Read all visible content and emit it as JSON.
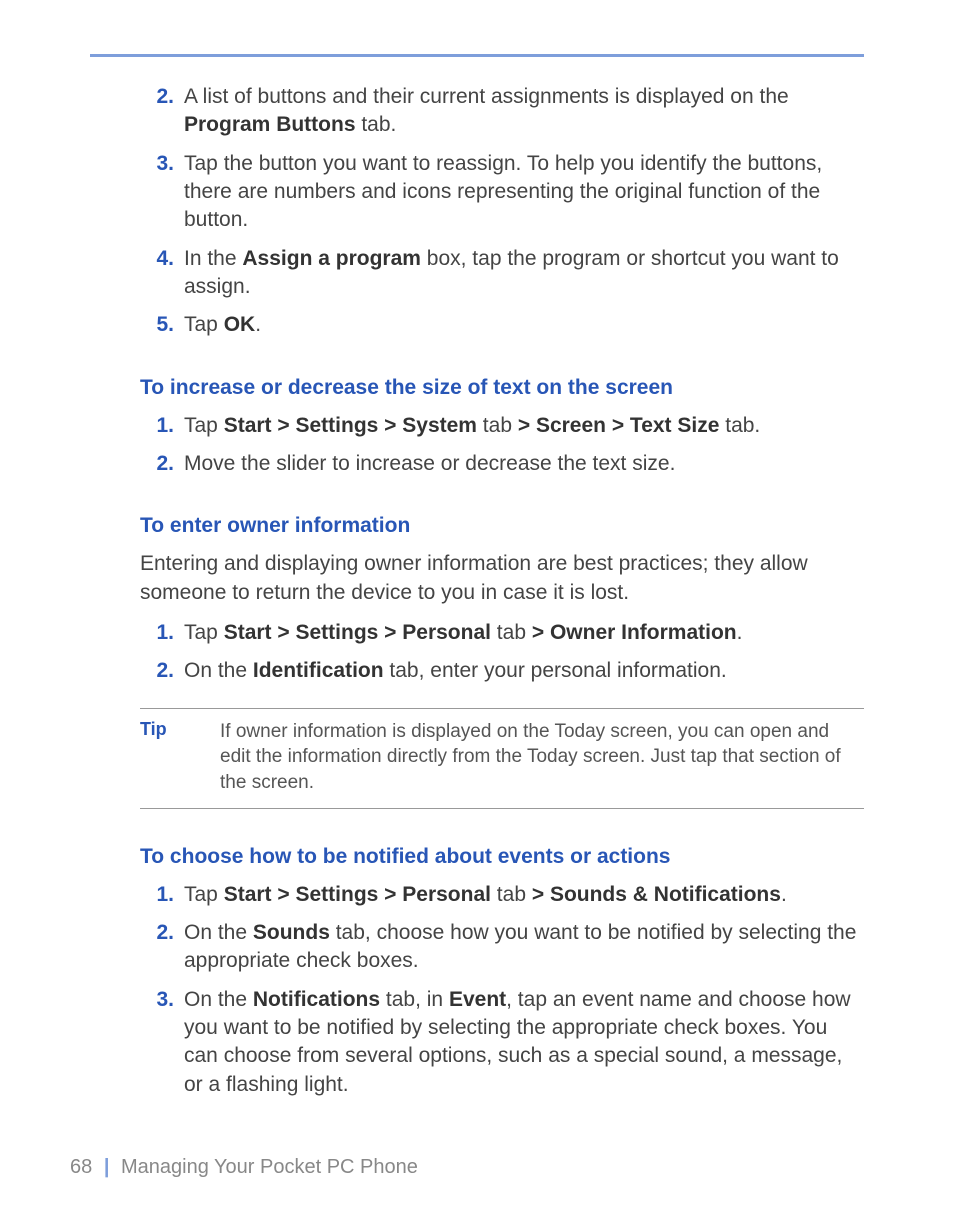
{
  "steps_top": [
    {
      "n": "2.",
      "html": "A list of buttons and their current assignments is displayed on the <span class='b'>Program Buttons</span> tab."
    },
    {
      "n": "3.",
      "html": "Tap the button you want to reassign. To help you identify the buttons, there are numbers and icons representing the original function of the button."
    },
    {
      "n": "4.",
      "html": "In the <span class='b'>Assign a program</span> box, tap the program or shortcut you want to assign."
    },
    {
      "n": "5.",
      "html": "Tap <span class='b'>OK</span>."
    }
  ],
  "section_textsize": {
    "heading": "To increase or decrease the size of text on the screen",
    "steps": [
      {
        "n": "1.",
        "html": "Tap <span class='b'>Start > Settings > System</span> tab <span class='b'>> Screen > Text Size</span> tab."
      },
      {
        "n": "2.",
        "html": "Move the slider to increase or decrease the text size."
      }
    ]
  },
  "section_owner": {
    "heading": "To enter owner information",
    "intro": "Entering and displaying owner information are best practices; they allow someone to return the device to you in case it is lost.",
    "steps": [
      {
        "n": "1.",
        "html": "Tap <span class='b'>Start > Settings > Personal</span> tab <span class='b'>> Owner Information</span>."
      },
      {
        "n": "2.",
        "html": "On the <span class='b'>Identification</span> tab, enter your personal information."
      }
    ],
    "tip_label": "Tip",
    "tip_body": "If owner information is displayed on the Today screen, you can open and edit the information directly from the Today screen. Just tap that section of the screen."
  },
  "section_notify": {
    "heading": "To choose how to be notified about events or actions",
    "steps": [
      {
        "n": "1.",
        "html": "Tap <span class='b'>Start > Settings > Personal</span> tab <span class='b'>> Sounds & Notifications</span>."
      },
      {
        "n": "2.",
        "html": "On the <span class='b'>Sounds</span> tab, choose how you want to be notified by selecting the appropriate check boxes."
      },
      {
        "n": "3.",
        "html": "On the <span class='b'>Notifications</span> tab, in <span class='b'>Event</span>, tap an event name and choose how you want to be notified by selecting the appropriate check boxes. You can choose from several options, such as a special sound, a message, or a flashing light."
      }
    ]
  },
  "footer": {
    "page": "68",
    "title": "Managing Your Pocket PC Phone"
  }
}
